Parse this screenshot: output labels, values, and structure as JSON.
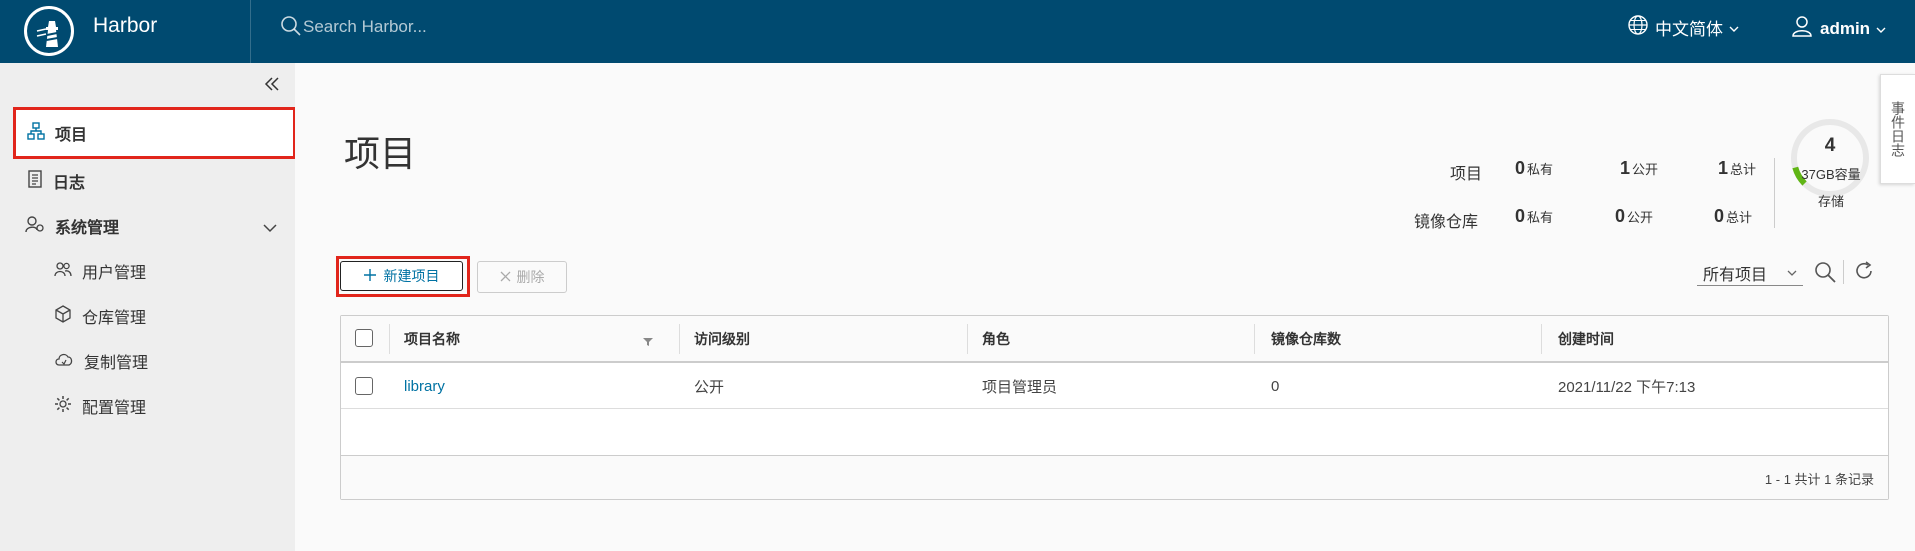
{
  "header": {
    "app_title": "Harbor",
    "search_placeholder": "Search Harbor...",
    "language": "中文简体",
    "user": "admin"
  },
  "sidebar": {
    "items": [
      {
        "label": "项目",
        "icon": "project-icon"
      },
      {
        "label": "日志",
        "icon": "log-icon"
      },
      {
        "label": "系统管理",
        "icon": "system-admin-icon"
      }
    ],
    "sub_items": [
      {
        "label": "用户管理",
        "icon": "users-icon"
      },
      {
        "label": "仓库管理",
        "icon": "registry-icon"
      },
      {
        "label": "复制管理",
        "icon": "replication-icon"
      },
      {
        "label": "配置管理",
        "icon": "config-icon"
      }
    ]
  },
  "main": {
    "title": "项目",
    "event_log_tab": "事件日志",
    "stats": {
      "project_label": "项目",
      "repo_label": "镜像仓库",
      "project_private": "0",
      "project_public": "1",
      "project_total": "1",
      "repo_private": "0",
      "repo_public": "0",
      "repo_total": "0",
      "private_unit": "私有",
      "public_unit": "公开",
      "total_unit": "总计"
    },
    "storage": {
      "count": "4",
      "capacity": "37GB容量",
      "label": "存储",
      "used_fraction": 0.11
    },
    "toolbar": {
      "new_project": "新建项目",
      "delete": "删除",
      "filter": "所有项目"
    },
    "table": {
      "headers": [
        "项目名称",
        "访问级别",
        "角色",
        "镜像仓库数",
        "创建时间"
      ],
      "rows": [
        {
          "name": "library",
          "access": "公开",
          "role": "项目管理员",
          "repo_count": "0",
          "created": "2021/11/22 下午7:13"
        }
      ],
      "footer": "1 - 1 共计 1 条记录"
    }
  },
  "colors": {
    "header_bg": "#004a70",
    "accent": "#0072a3",
    "highlight_box": "#e1251b",
    "gauge_fill": "#60b515"
  }
}
